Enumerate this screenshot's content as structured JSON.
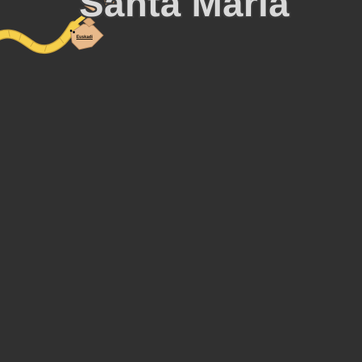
{
  "map": {
    "place_label": "Santa Maria",
    "poi_label": "Euskadi",
    "colors": {
      "background": "#303030",
      "road": "#f6cf4a",
      "road_edge": "#c9a23a",
      "building": "#e8b98a",
      "building_edge": "#b88a60",
      "label_text": "#d9d9d9"
    }
  }
}
